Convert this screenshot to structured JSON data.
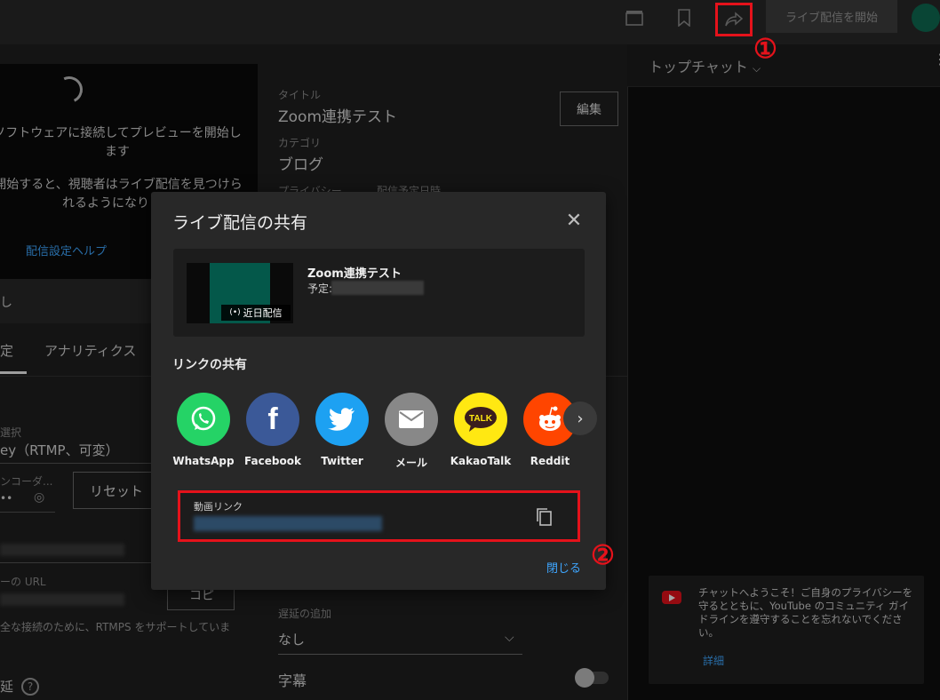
{
  "topbar": {
    "go_live_label": "ライブ配信を開始",
    "callout_1": "①"
  },
  "preview": {
    "message_1": "ソフトウェアに接続してプレビューを開始します",
    "message_2": "開始すると、視聴者はライブ配信を見つけられるようになります",
    "help_link": "配信設定ヘルプ"
  },
  "details": {
    "title_label": "タイトル",
    "title_value": "Zoom連携テスト",
    "category_label": "カテゴリ",
    "category_value": "ブログ",
    "privacy_label": "プライバシー",
    "schedule_label": "配信予定日時",
    "edit_button": "編集"
  },
  "tabs": {
    "analytics": "アナリティクス"
  },
  "stream_settings": {
    "key_select_label": "選択",
    "key_value": "ey（RTMP、可変）",
    "encoder_label": "ンコーダ...",
    "reset_button": "リセット",
    "url_label": "ーの URL",
    "copy_button": "コピ",
    "rtmps_note": "全な接続のために、RTMPS をサポートしていま",
    "latency_label": "延",
    "add_delay_label": "遅延の追加",
    "add_delay_value": "なし",
    "captions_label": "字幕"
  },
  "chat": {
    "title": "トップチャット",
    "welcome": "チャットへようこそ！ご自身のプライバシーを守るとともに、YouTube のコミュニティ ガイドラインを遵守することを忘れないでください。",
    "details_link": "詳細"
  },
  "modal": {
    "title": "ライブ配信の共有",
    "video_title": "Zoom連携テスト",
    "scheduled_prefix": "予定:",
    "badge": "近日配信",
    "link_share_title": "リンクの共有",
    "share_targets": [
      {
        "label": "WhatsApp",
        "icon": "whatsapp-icon",
        "color": "#25d366"
      },
      {
        "label": "Facebook",
        "icon": "facebook-icon",
        "color": "#3b5998"
      },
      {
        "label": "Twitter",
        "icon": "twitter-icon",
        "color": "#1da1f2"
      },
      {
        "label": "メール",
        "icon": "mail-icon",
        "color": "#888888"
      },
      {
        "label": "KakaoTalk",
        "icon": "kakaotalk-icon",
        "color": "#ffe812"
      },
      {
        "label": "Reddit",
        "icon": "reddit-icon",
        "color": "#ff4500"
      }
    ],
    "video_link_label": "動画リンク",
    "close_button": "閉じる",
    "callout_2": "②"
  },
  "colors": {
    "accent_blue": "#3ea6ff",
    "highlight_red": "#e5121b"
  }
}
